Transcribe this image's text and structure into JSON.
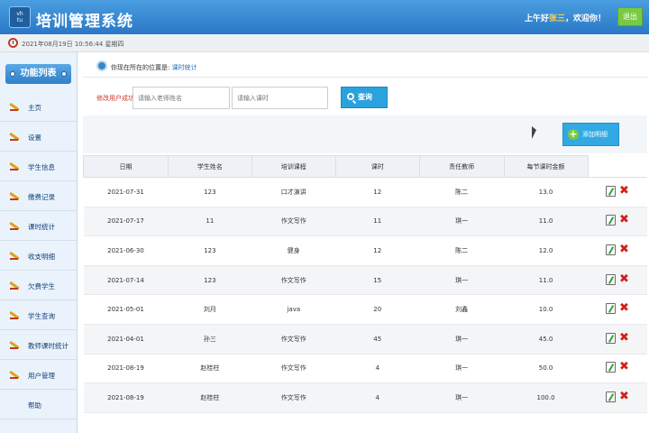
{
  "header": {
    "logo_text": "vh\ntu",
    "title": "培训管理系统",
    "greeting_prefix": "上午好",
    "username": "张三",
    "greeting_suffix": "，欢迎你！",
    "logout_label": "退出"
  },
  "datebar": {
    "text": "2021年08月19日 10:56:44 星期四"
  },
  "sidebar": {
    "title": "功能列表",
    "items": [
      {
        "label": "主页"
      },
      {
        "label": "设置"
      },
      {
        "label": "学生信息"
      },
      {
        "label": "缴费记录"
      },
      {
        "label": "课时统计"
      },
      {
        "label": "收支明细"
      },
      {
        "label": "欠费学生"
      },
      {
        "label": "学生查询"
      },
      {
        "label": "教师课时统计"
      },
      {
        "label": "用户管理"
      },
      {
        "label": "帮助"
      }
    ]
  },
  "breadcrumb": {
    "prefix": "你现在所在的位置是: ",
    "current": "课时统计"
  },
  "search": {
    "message": "修改用户成功",
    "name_placeholder": "请输入老师姓名",
    "hours_placeholder": "请输入课时",
    "button_label": "查询"
  },
  "toolbar": {
    "add_label": "添加明细"
  },
  "table": {
    "headers": [
      "日期",
      "学生姓名",
      "培训课程",
      "课时",
      "责任教师",
      "每节课时金额"
    ],
    "rows": [
      [
        "2021-07-31",
        "123",
        "口才演讲",
        "12",
        "陈二",
        "13.0"
      ],
      [
        "2021-07-17",
        "11",
        "作文写作",
        "11",
        "琪一",
        "11.0"
      ],
      [
        "2021-06-30",
        "123",
        "健身",
        "12",
        "陈二",
        "12.0"
      ],
      [
        "2021-07-14",
        "123",
        "作文写作",
        "15",
        "琪一",
        "11.0"
      ],
      [
        "2021-05-01",
        "刘月",
        "java",
        "20",
        "刘鑫",
        "10.0"
      ],
      [
        "2021-04-01",
        "孙三",
        "作文写作",
        "45",
        "琪一",
        "45.0"
      ],
      [
        "2021-08-19",
        "赵桂柱",
        "作文写作",
        "4",
        "琪一",
        "50.0"
      ],
      [
        "2021-08-19",
        "赵桂柱",
        "作文写作",
        "4",
        "琪一",
        "100.0"
      ]
    ],
    "delete_glyph": "✖"
  }
}
